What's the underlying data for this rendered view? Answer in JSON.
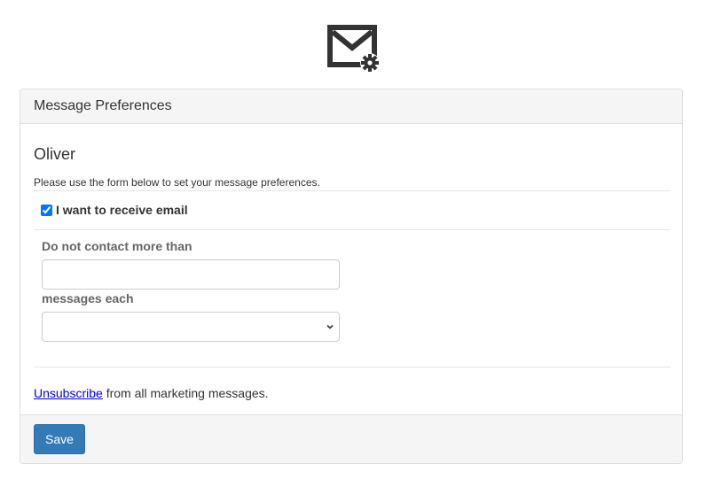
{
  "logo": {
    "icon": "envelope-gear-icon",
    "color": "#333333"
  },
  "panel": {
    "title": "Message Preferences",
    "user_name": "Oliver",
    "intro_text": "Please use the form below to set your message preferences.",
    "receive_email": {
      "label": "I want to receive email",
      "checked": true
    },
    "limit": {
      "label": "Do not contact more than",
      "value": "",
      "period_label": "messages each",
      "period_selected": ""
    },
    "unsubscribe": {
      "link_text": "Unsubscribe",
      "rest_text": " from all marketing messages."
    },
    "footer": {
      "save_label": "Save"
    }
  },
  "colors": {
    "primary": "#337ab7",
    "link": "#0000ee",
    "panel_bg": "#f5f5f5",
    "border": "#dddddd"
  }
}
